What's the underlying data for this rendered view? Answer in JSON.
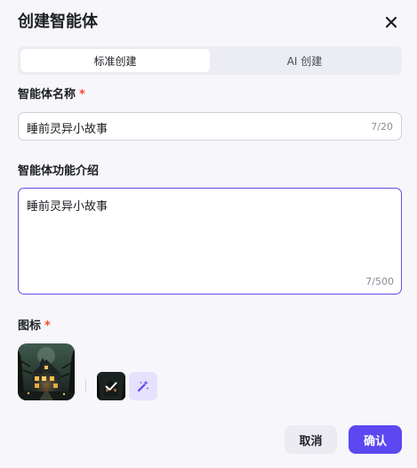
{
  "dialog": {
    "title": "创建智能体"
  },
  "tabs": [
    {
      "label": "标准创建",
      "active": true
    },
    {
      "label": "AI 创建",
      "active": false
    }
  ],
  "name_field": {
    "label": "智能体名称",
    "required_mark": "*",
    "value": "睡前灵异小故事",
    "counter": "7/20"
  },
  "desc_field": {
    "label": "智能体功能介绍",
    "value": "睡前灵异小故事",
    "counter": "7/500"
  },
  "icon_field": {
    "label": "图标",
    "required_mark": "*",
    "main_icon": "haunted-house-avatar",
    "small_icon": "haunted-house-thumbnail-selected",
    "generate_icon": "sparkle-wand-icon"
  },
  "footer": {
    "cancel_label": "取消",
    "confirm_label": "确认"
  },
  "colors": {
    "accent": "#5b48f0",
    "focus_border": "#5b4fe3",
    "required": "#f5482f",
    "background": "#f7f7fb"
  }
}
